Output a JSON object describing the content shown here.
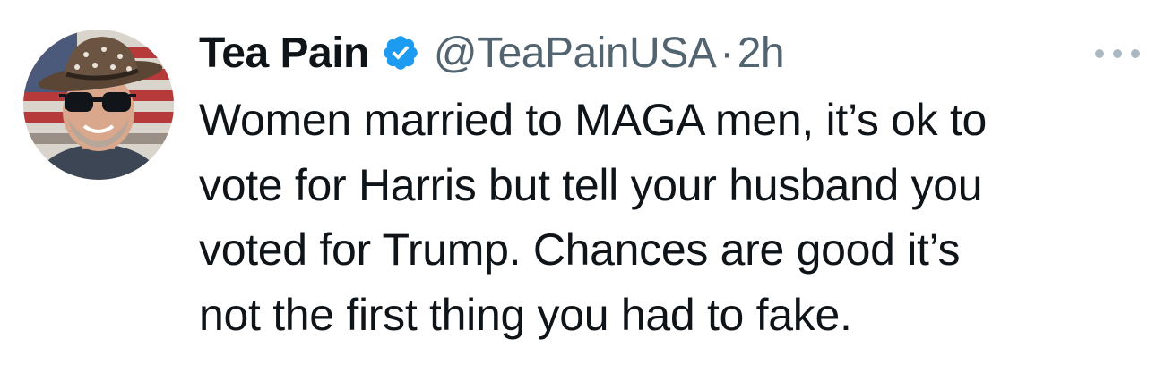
{
  "tweet": {
    "author": {
      "display_name": "Tea Pain",
      "handle": "@TeaPainUSA",
      "verified": true,
      "avatar": "profile-photo-cowboy-hat-sunglasses"
    },
    "separator": "·",
    "timestamp": "2h",
    "more_icon": "ellipsis-icon",
    "verified_icon": "verified-badge-icon",
    "text_lines": [
      "Women married to MAGA men, it’s ok to",
      "vote for Harris but tell your husband you",
      "voted for Trump. Chances are good it’s",
      "not the first thing you had to fake."
    ]
  },
  "colors": {
    "text_primary": "#0f1419",
    "text_secondary": "#536471",
    "verified_blue": "#1d9bf0",
    "more_dots": "#aab8c2",
    "background": "#ffffff"
  }
}
